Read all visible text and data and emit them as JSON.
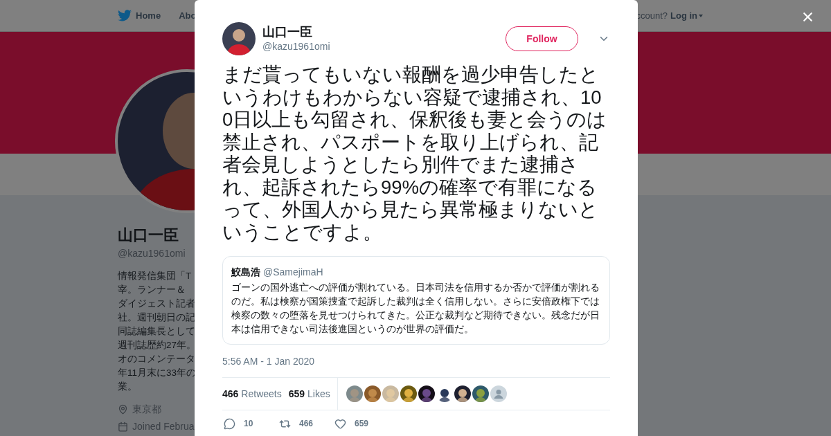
{
  "nav": {
    "items": [
      {
        "label": "Home"
      },
      {
        "label": "Abo"
      }
    ],
    "account_prompt": "ccount?",
    "login": "Log in"
  },
  "profile": {
    "name": "山口一臣",
    "handle": "@kazu1961omi",
    "bio_lines": [
      "情報発信集団「T",
      "宰。ランナー＆",
      "ダイジェスト記者",
      "社。週刊朝日の記",
      "同誌編集長として",
      "週刊誌歴約27年。",
      "オのコメンテータ",
      "年11月末に33年の",
      "業。"
    ],
    "location": "東京都",
    "joined": "Joined Februa"
  },
  "tweet": {
    "author": {
      "name": "山口一臣",
      "handle": "@kazu1961omi"
    },
    "follow": "Follow",
    "text": "まだ貰ってもいない報酬を過少申告したというわけもわからない容疑で逮捕され、100日以上も勾留され、保釈後も妻と会うのは禁止され、パスポートを取り上げられ、記者会見しようとしたら別件でまた逮捕され、起訴されたら99%の確率で有罪になるって、外国人から見たら異常極まりないということですよ。",
    "quote": {
      "name": "鮫島浩",
      "handle": "@SamejimaH",
      "text": "ゴーンの国外逃亡への評価が割れている。日本司法を信用するか否かで評価が割れるのだ。私は検察が国策捜査で起訴した裁判は全く信用しない。さらに安倍政権下では検察の数々の堕落を見せつけられてきた。公正な裁判など期待できない。残念だが日本は信用できない司法後進国というのが世界の評価だ。"
    },
    "timestamp": "5:56 AM - 1 Jan 2020",
    "stats": [
      {
        "count": "466",
        "label": "Retweets"
      },
      {
        "count": "659",
        "label": "Likes"
      }
    ],
    "actions": [
      {
        "kind": "reply",
        "count": "10"
      },
      {
        "kind": "retweet",
        "count": "466"
      },
      {
        "kind": "like",
        "count": "659"
      }
    ]
  }
}
